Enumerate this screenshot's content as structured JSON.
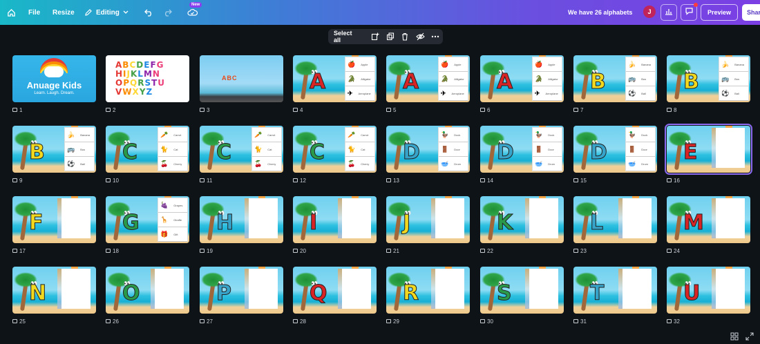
{
  "topbar": {
    "file_label": "File",
    "resize_label": "Resize",
    "editing_label": "Editing",
    "new_badge": "New",
    "title": "We have 26 alphabets",
    "avatar_initial": "J",
    "preview_label": "Preview",
    "share_label": "Shar"
  },
  "floating_toolbar": {
    "select_all_label": "Select all"
  },
  "slides": [
    {
      "n": "1",
      "kind": "logo",
      "title": "Anuage Kids",
      "sub": "Learn. Laugh. Dream."
    },
    {
      "n": "2",
      "kind": "alphabet",
      "lines": [
        "ABCDEFG",
        "HIJKLMN",
        "OPQRSTU",
        "VWXYZ"
      ]
    },
    {
      "n": "3",
      "kind": "abc",
      "text": "ABC"
    },
    {
      "n": "4",
      "kind": "panel",
      "letter": "A",
      "color": "#d82424",
      "items": [
        "🍎",
        "🐊",
        "✈"
      ],
      "labels": [
        "Apple",
        "Alligator",
        "Aeroplane"
      ]
    },
    {
      "n": "5",
      "kind": "panel",
      "letter": "A",
      "color": "#d82424",
      "items": [
        "🍎",
        "🐊",
        "✈"
      ],
      "labels": [
        "Apple",
        "Alligator",
        "Aeroplane"
      ]
    },
    {
      "n": "6",
      "kind": "panel",
      "letter": "A",
      "color": "#d82424",
      "items": [
        "🍎",
        "🐊",
        "✈"
      ],
      "labels": [
        "Apple",
        "Alligator",
        "Aeroplane"
      ]
    },
    {
      "n": "7",
      "kind": "panel",
      "letter": "B",
      "color": "#f2d91f",
      "items": [
        "🍌",
        "🚌",
        "⚽"
      ],
      "labels": [
        "Banana",
        "Bus",
        "Ball"
      ]
    },
    {
      "n": "8",
      "kind": "panel",
      "letter": "B",
      "color": "#f2d91f",
      "items": [
        "🍌",
        "🚌",
        "⚽"
      ],
      "labels": [
        "Banana",
        "Bus",
        "Ball"
      ]
    },
    {
      "n": "9",
      "kind": "panel",
      "letter": "B",
      "color": "#f2d91f",
      "items": [
        "🍌",
        "🚌",
        "⚽"
      ],
      "labels": [
        "Banana",
        "Bus",
        "Ball"
      ]
    },
    {
      "n": "10",
      "kind": "panel",
      "letter": "C",
      "color": "#2a9a4a",
      "items": [
        "🥕",
        "🐈",
        "🍒"
      ],
      "labels": [
        "Carrot",
        "Cat",
        "Cherry"
      ]
    },
    {
      "n": "11",
      "kind": "panel",
      "letter": "C",
      "color": "#2a9a4a",
      "items": [
        "🥕",
        "🐈",
        "🍒"
      ],
      "labels": [
        "Carrot",
        "Cat",
        "Cherry"
      ]
    },
    {
      "n": "12",
      "kind": "panel",
      "letter": "C",
      "color": "#2a9a4a",
      "items": [
        "🥕",
        "🐈",
        "🍒"
      ],
      "labels": [
        "Carrot",
        "Cat",
        "Cherry"
      ]
    },
    {
      "n": "13",
      "kind": "panel",
      "letter": "D",
      "color": "#38a3c8",
      "items": [
        "🦆",
        "🚪",
        "🥣"
      ],
      "labels": [
        "Duck",
        "Door",
        "Drum"
      ]
    },
    {
      "n": "14",
      "kind": "panel",
      "letter": "D",
      "color": "#38a3c8",
      "items": [
        "🦆",
        "🚪",
        "🥣"
      ],
      "labels": [
        "Duck",
        "Door",
        "Drum"
      ]
    },
    {
      "n": "15",
      "kind": "panel",
      "letter": "D",
      "color": "#38a3c8",
      "items": [
        "🦆",
        "🚪",
        "🥣"
      ],
      "labels": [
        "Duck",
        "Door",
        "Drum"
      ]
    },
    {
      "n": "16",
      "kind": "blank",
      "letter": "E",
      "color": "#d82424",
      "selected": true
    },
    {
      "n": "17",
      "kind": "blank",
      "letter": "F",
      "color": "#f2d91f"
    },
    {
      "n": "18",
      "kind": "panel",
      "letter": "G",
      "color": "#2a9a4a",
      "items": [
        "🍇",
        "🦒",
        "🎁"
      ],
      "labels": [
        "Grapes",
        "Giraffe",
        "Gift"
      ]
    },
    {
      "n": "19",
      "kind": "blank",
      "letter": "H",
      "color": "#38a3c8"
    },
    {
      "n": "20",
      "kind": "blank",
      "letter": "I",
      "color": "#d82424"
    },
    {
      "n": "21",
      "kind": "blank",
      "letter": "J",
      "color": "#f2d91f"
    },
    {
      "n": "22",
      "kind": "blank",
      "letter": "K",
      "color": "#2a9a4a"
    },
    {
      "n": "23",
      "kind": "blank",
      "letter": "L",
      "color": "#38a3c8"
    },
    {
      "n": "24",
      "kind": "blank",
      "letter": "M",
      "color": "#d82424"
    },
    {
      "n": "25",
      "kind": "blank",
      "letter": "N",
      "color": "#f2d91f"
    },
    {
      "n": "26",
      "kind": "blank",
      "letter": "O",
      "color": "#2a9a4a"
    },
    {
      "n": "27",
      "kind": "blank",
      "letter": "P",
      "color": "#38a3c8"
    },
    {
      "n": "28",
      "kind": "blank",
      "letter": "Q",
      "color": "#d82424"
    },
    {
      "n": "29",
      "kind": "blank",
      "letter": "R",
      "color": "#f2d91f"
    },
    {
      "n": "30",
      "kind": "blank",
      "letter": "S",
      "color": "#2a9a4a"
    },
    {
      "n": "31",
      "kind": "blank",
      "letter": "T",
      "color": "#38a3c8"
    },
    {
      "n": "32",
      "kind": "blank",
      "letter": "U",
      "color": "#d82424"
    }
  ]
}
